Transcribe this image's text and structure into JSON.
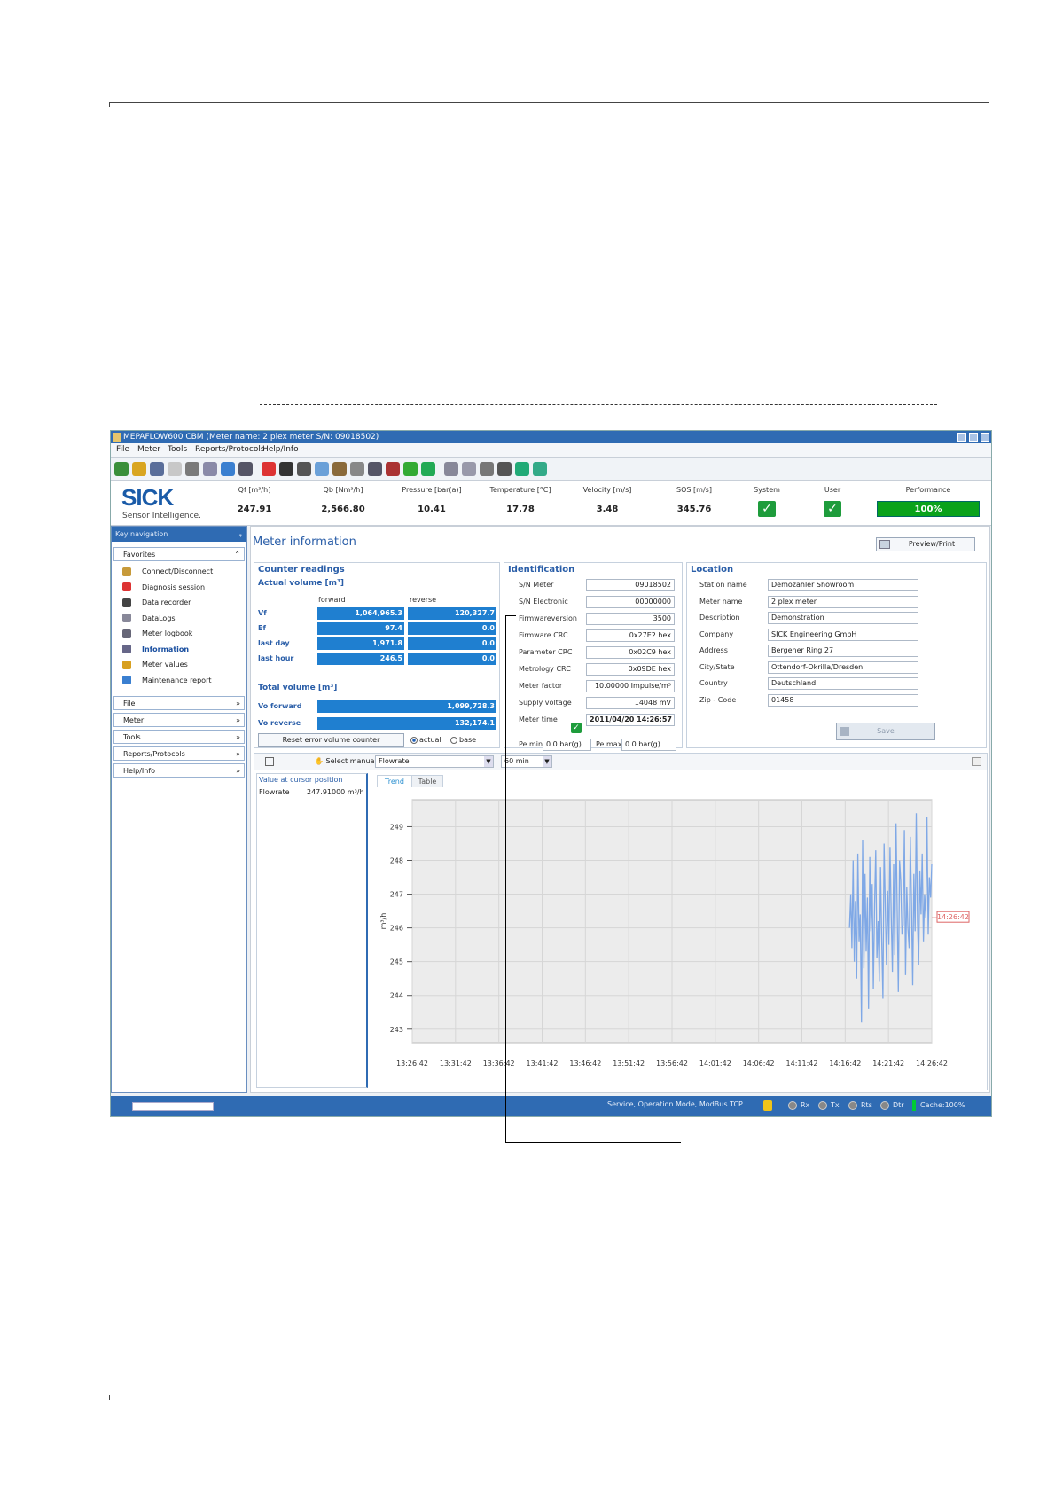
{
  "window": {
    "title": "MEPAFLOW600 CBM (Meter name: 2 plex meter S/N: 09018502)"
  },
  "menu": [
    "File",
    "Meter",
    "Tools",
    "Reports/Protocols",
    "Help/Info"
  ],
  "toolbar_icons": [
    "connect-icon",
    "diagnosis-icon",
    "book-icon",
    "plug-icon",
    "disconnect-icon",
    "gear-icon",
    "users-icon",
    "monitor-icon",
    "plus-icon",
    "recorder-icon",
    "binoculars-icon",
    "calculator-icon",
    "scale-icon",
    "report-icon",
    "wrench-icon",
    "palette-icon",
    "gauge-icon",
    "tools-icon",
    "page-icon",
    "print-icon",
    "hands-icon",
    "list-icon",
    "chart-icon",
    "bar-chart-icon"
  ],
  "header": {
    "logo": "SICK",
    "tagline": "Sensor Intelligence.",
    "measurements": [
      {
        "label": "Qf [m³/h]",
        "value": "247.91"
      },
      {
        "label": "Qb [Nm³/h]",
        "value": "2,566.80"
      },
      {
        "label": "Pressure [bar(a)]",
        "value": "10.41"
      },
      {
        "label": "Temperature [°C]",
        "value": "17.78"
      },
      {
        "label": "Velocity [m/s]",
        "value": "3.48"
      },
      {
        "label": "SOS [m/s]",
        "value": "345.76"
      }
    ],
    "system_label": "System",
    "user_label": "User",
    "performance_label": "Performance",
    "performance_value": "100%",
    "performance_fraction": 1.0
  },
  "nav": {
    "title": "Key navigation",
    "favorites_label": "Favorites",
    "favorites": [
      "Connect/Disconnect",
      "Diagnosis session",
      "Data recorder",
      "DataLogs",
      "Meter logbook",
      "Information",
      "Meter values",
      "Maintenance report"
    ],
    "active": "Information",
    "sections": [
      "File",
      "Meter",
      "Tools",
      "Reports/Protocols",
      "Help/Info"
    ]
  },
  "main": {
    "title": "Meter information",
    "preview_button": "Preview/Print",
    "counter": {
      "title": "Counter readings",
      "actual_title": "Actual volume [m³]",
      "col_forward": "forward",
      "col_reverse": "reverse",
      "rows": [
        {
          "label": "Vf",
          "forward": "1,064,965.3",
          "reverse": "120,327.7"
        },
        {
          "label": "Ef",
          "forward": "97.4",
          "reverse": "0.0"
        },
        {
          "label": "last day",
          "forward": "1,971.8",
          "reverse": "0.0"
        },
        {
          "label": "last hour",
          "forward": "246.5",
          "reverse": "0.0"
        }
      ],
      "total_title": "Total volume [m³]",
      "totals": [
        {
          "label": "Vo forward",
          "value": "1,099,728.3"
        },
        {
          "label": "Vo reverse",
          "value": "132,174.1"
        }
      ],
      "reset_button": "Reset error volume counter",
      "radio_actual": "actual",
      "radio_base": "base"
    },
    "identification": {
      "title": "Identification",
      "rows": [
        {
          "label": "S/N Meter",
          "value": "09018502"
        },
        {
          "label": "S/N Electronic",
          "value": "00000000"
        },
        {
          "label": "Firmwareversion",
          "value": "3500"
        },
        {
          "label": "Firmware CRC",
          "value": "0x27E2 hex"
        },
        {
          "label": "Parameter CRC",
          "value": "0x02C9 hex"
        },
        {
          "label": "Metrology CRC",
          "value": "0x09DE hex"
        },
        {
          "label": "Meter factor",
          "value": "10.00000 Impulse/m³"
        },
        {
          "label": "Supply voltage",
          "value": "14048 mV"
        },
        {
          "label": "Meter time",
          "value": "2011/04/20   14:26:57"
        }
      ],
      "pe_min_label": "Pe min",
      "pe_min": "0.0 bar(g)",
      "pe_max_label": "Pe max",
      "pe_max": "0.0 bar(g)"
    },
    "location": {
      "title": "Location",
      "rows": [
        {
          "label": "Station name",
          "value": "Demozähler Showroom"
        },
        {
          "label": "Meter name",
          "value": "2 plex meter"
        },
        {
          "label": "Description",
          "value": "Demonstration"
        },
        {
          "label": "Company",
          "value": "SICK Engineering GmbH"
        },
        {
          "label": "Address",
          "value": "Bergener Ring 27"
        },
        {
          "label": "City/State",
          "value": "Ottendorf-Okrilla/Dresden"
        },
        {
          "label": "Country",
          "value": "Deutschland"
        },
        {
          "label": "Zip - Code",
          "value": "01458"
        }
      ],
      "save_button": "Save"
    },
    "trend": {
      "select_manually": "Select manually",
      "select_value": "Flowrate",
      "range_value": "60 min",
      "cursor_title": "Value at cursor position",
      "cursor_label": "Flowrate",
      "cursor_value": "247.91000 m³/h",
      "tab_trend": "Trend",
      "tab_table": "Table",
      "cursor_time": "14:26:42"
    }
  },
  "chart_data": {
    "type": "line",
    "ylabel": "m³/h",
    "ylim": [
      242.6,
      249.8
    ],
    "yticks": [
      "249",
      "248",
      "247",
      "246",
      "245",
      "244",
      "243"
    ],
    "xticks": [
      "13:26:42",
      "13:31:42",
      "13:36:42",
      "13:41:42",
      "13:46:42",
      "13:51:42",
      "13:56:42",
      "14:01:42",
      "14:06:42",
      "14:11:42",
      "14:16:42",
      "14:21:42",
      "14:26:42"
    ],
    "grid": true,
    "series": [
      {
        "color": "#7fa8e6",
        "x_start_minute": 50.5,
        "values": [
          246.0,
          247.0,
          245.4,
          248.0,
          245.0,
          246.8,
          244.5,
          248.2,
          245.6,
          246.4,
          243.2,
          248.6,
          244.8,
          247.6,
          245.3,
          246.9,
          243.6,
          248.1,
          245.9,
          247.3,
          244.2,
          246.7,
          248.3,
          245.1,
          246.2,
          244.4,
          247.8,
          245.7,
          243.9,
          248.5,
          246.6,
          244.9,
          247.1,
          245.5,
          248.4,
          246.3,
          244.7,
          247.9,
          245.2,
          249.1,
          246.5,
          244.1,
          248.0,
          247.4,
          245.8,
          246.1,
          248.9,
          244.6,
          247.2,
          246.0,
          245.4,
          248.7,
          246.8,
          244.3,
          247.6,
          245.9,
          249.4,
          246.2,
          244.9,
          247.7,
          246.4,
          248.2,
          245.6,
          247.0,
          246.3,
          249.3,
          245.8,
          247.5,
          246.9,
          247.9
        ]
      }
    ]
  }
}
